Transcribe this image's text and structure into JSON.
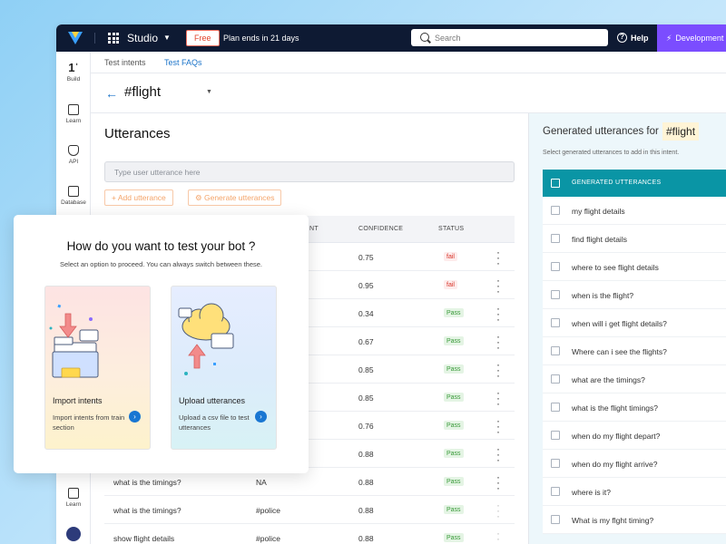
{
  "topbar": {
    "product": "Studio",
    "free_badge": "Free",
    "plan_text": "Plan ends in 21 days",
    "search_placeholder": "Search",
    "help": "Help",
    "dev_label": "Development"
  },
  "sidebar": {
    "items": [
      {
        "label": "Build",
        "icon": "build-icon"
      },
      {
        "label": "Learn",
        "icon": "learn-icon"
      },
      {
        "label": "API",
        "icon": "api-icon"
      },
      {
        "label": "Database",
        "icon": "database-icon"
      },
      {
        "label": "Learn",
        "icon": "book-icon"
      }
    ]
  },
  "subtabs": [
    "Test intents",
    "Test FAQs"
  ],
  "intent": {
    "title": "#flight"
  },
  "utterances": {
    "title": "Utterances",
    "input_placeholder": "Type user utterance here",
    "add_label": "+ Add utterance",
    "generate_label": "Generate utterances",
    "col_intent": "NT",
    "col_confidence": "CONFIDENCE",
    "col_status": "STATUS",
    "rows": [
      {
        "utterance": "",
        "intent": "",
        "confidence": "0.75",
        "status": "fail"
      },
      {
        "utterance": "",
        "intent": "",
        "confidence": "0.95",
        "status": "fail"
      },
      {
        "utterance": "",
        "intent": "",
        "confidence": "0.34",
        "status": "Pass"
      },
      {
        "utterance": "",
        "intent": "",
        "confidence": "0.67",
        "status": "Pass"
      },
      {
        "utterance": "",
        "intent": "",
        "confidence": "0.85",
        "status": "Pass"
      },
      {
        "utterance": "",
        "intent": "",
        "confidence": "0.85",
        "status": "Pass"
      },
      {
        "utterance": "",
        "intent": "",
        "confidence": "0.76",
        "status": "Pass"
      },
      {
        "utterance": "",
        "intent": "",
        "confidence": "0.88",
        "status": "Pass"
      },
      {
        "utterance": "what is the timings?",
        "intent": "NA",
        "confidence": "0.88",
        "status": "Pass"
      },
      {
        "utterance": "what is the timings?",
        "intent": "#police",
        "confidence": "0.88",
        "status": "Pass"
      },
      {
        "utterance": "show flight details",
        "intent": "#police",
        "confidence": "0.88",
        "status": "Pass"
      }
    ]
  },
  "generated": {
    "title": "Generated utterances for",
    "intent": "#flight",
    "subtitle": "Select generated utterances to add in this intent.",
    "header": "GENERATED UTTERANCES",
    "items": [
      "my flight details",
      "find flight details",
      "where to see flight details",
      "when is the flight?",
      "when will i get flight details?",
      "Where can i see the flights?",
      "what are the timings?",
      "what is the flight timings?",
      "when do my flight depart?",
      "when do my flight arrive?",
      "where is it?",
      "What is my flght timing?"
    ]
  },
  "modal": {
    "title": "How do you want to test your bot ?",
    "subtitle": "Select an option to proceed. You can always switch between these.",
    "import_title": "Import intents",
    "import_desc": "Import intents from train section",
    "upload_title": "Upload utterances",
    "upload_desc": "Upload a csv file to test utterances"
  },
  "colors": {
    "topbar": "#0e1a33",
    "dev": "#7b4dff",
    "teal": "#0a95a5",
    "link": "#1a73c9",
    "orange": "#f4a56b"
  }
}
